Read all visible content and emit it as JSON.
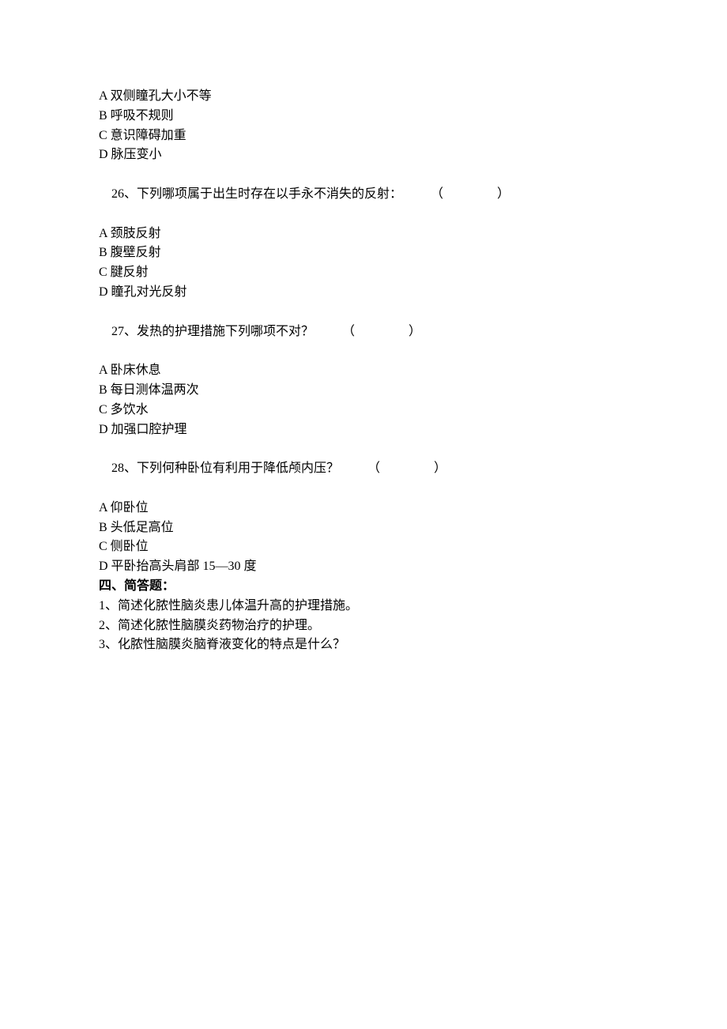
{
  "options_pre": [
    "A 双侧瞳孔大小不等",
    "B 呼吸不规则",
    "C 意识障碍加重",
    "D 脉压变小"
  ],
  "q26": {
    "stem": "26、下列哪项属于出生时存在以手永不消失的反射：",
    "paren_open": "（",
    "paren_close": "）",
    "options": [
      "A 颈肢反射",
      "B 腹壁反射",
      "C 腱反射",
      "D 瞳孔对光反射"
    ]
  },
  "q27": {
    "stem": "27、发热的护理措施下列哪项不对？",
    "paren_open": "（",
    "paren_close": "）",
    "options": [
      "A 卧床休息",
      "B 每日测体温两次",
      "C 多饮水",
      "D 加强口腔护理"
    ]
  },
  "q28": {
    "stem": "28、下列何种卧位有利用于降低颅内压？",
    "paren_open": "（",
    "paren_close": "）",
    "options": [
      "A 仰卧位",
      "B 头低足高位",
      "C 侧卧位",
      "D 平卧抬高头肩部 15—30 度"
    ]
  },
  "section4": {
    "heading": "四、简答题：",
    "items": [
      "1、简述化脓性脑炎患儿体温升高的护理措施。",
      "2、简述化脓性脑膜炎药物治疗的护理。",
      "3、化脓性脑膜炎脑脊液变化的特点是什么？"
    ]
  }
}
